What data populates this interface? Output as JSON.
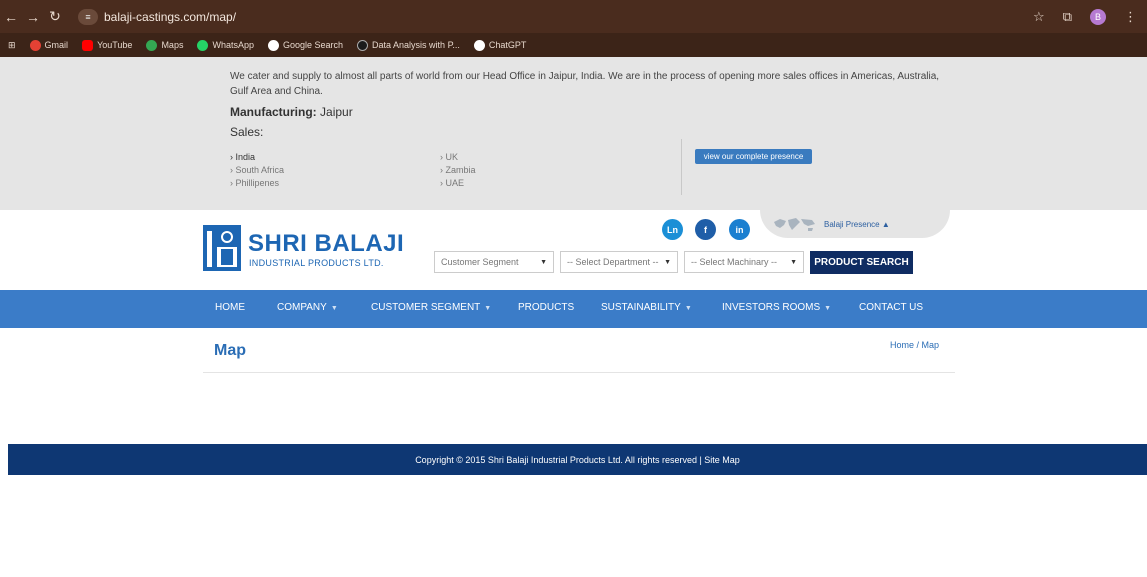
{
  "browser": {
    "url": "balaji-castings.com/map/",
    "profile_initial": "B",
    "bookmarks": [
      {
        "label": "Gmail",
        "color": "#e44134"
      },
      {
        "label": "YouTube",
        "color": "#ff0000"
      },
      {
        "label": "Maps",
        "color": "#34a853"
      },
      {
        "label": "WhatsApp",
        "color": "#25d366"
      },
      {
        "label": "Google Search",
        "color": "#ffffff"
      },
      {
        "label": "Data Analysis with P...",
        "color": "#1b1b1b"
      },
      {
        "label": "ChatGPT",
        "color": "#ffffff"
      }
    ]
  },
  "info": {
    "text": "We cater and supply to almost all parts of world from our Head Office in Jaipur, India. We are in the process of opening more sales offices in Americas, Australia, Gulf Area and China.",
    "manufacturing_label": "Manufacturing:",
    "manufacturing_value": "Jaipur",
    "sales_label": "Sales:",
    "sales_col1": [
      "India",
      "South Africa",
      "Phillipenes"
    ],
    "sales_col2": [
      "UK",
      "Zambia",
      "UAE"
    ],
    "presence_button": "view our complete presence"
  },
  "header": {
    "social": [
      {
        "label": "Ln",
        "color": "#1b8fd6"
      },
      {
        "label": "f",
        "color": "#1f5ea8"
      },
      {
        "label": "in",
        "color": "#1b7fd0"
      }
    ],
    "presence_link": "Balaji Presence",
    "logo_name": "SHRI BALAJI",
    "logo_sub": "INDUSTRIAL PRODUCTS LTD.",
    "selects": {
      "customer_segment": "Customer Segment",
      "department": "-- Select Department --",
      "machinary": "-- Select Machinary --"
    },
    "search_button": "PRODUCT SEARCH"
  },
  "nav": {
    "items": [
      "HOME",
      "COMPANY",
      "CUSTOMER SEGMENT",
      "PRODUCTS",
      "SUSTAINABILITY",
      "INVESTORS ROOMS",
      "CONTACT US"
    ]
  },
  "content": {
    "title": "Map",
    "breadcrumb": "Home / Map"
  },
  "footer": {
    "text": "Copyright © 2015 Shri Balaji Industrial Products Ltd. All rights reserved | Site Map"
  },
  "colors": {
    "nav_bg": "#3b7cc8",
    "footer_bg": "#0e3773",
    "brand_blue": "#1d66b3",
    "search_btn": "#0f2c62"
  }
}
